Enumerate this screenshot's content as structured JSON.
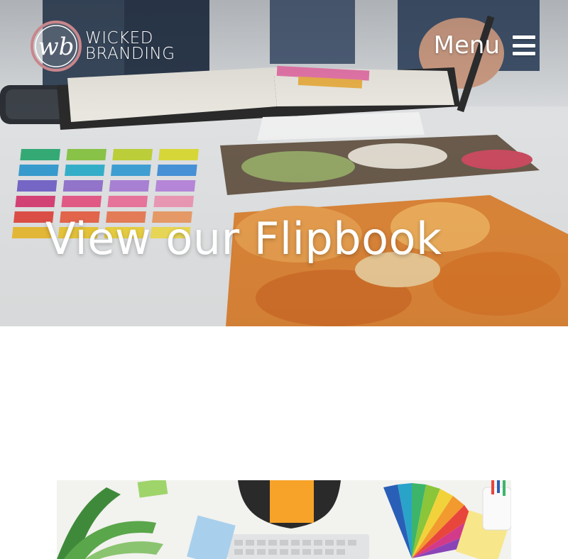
{
  "header": {
    "logo_monogram": "wb",
    "logo_line1": "WICKED",
    "logo_line2": "BRANDING",
    "menu_label": "Menu"
  },
  "hero": {
    "title": "View our Flipbook"
  },
  "colors": {
    "hero_text": "#ffffff",
    "page_background": "#ffffff",
    "logo_ring": "#c9868c"
  },
  "icons": {
    "menu": "hamburger-icon",
    "logo": "wb-monogram-icon"
  }
}
